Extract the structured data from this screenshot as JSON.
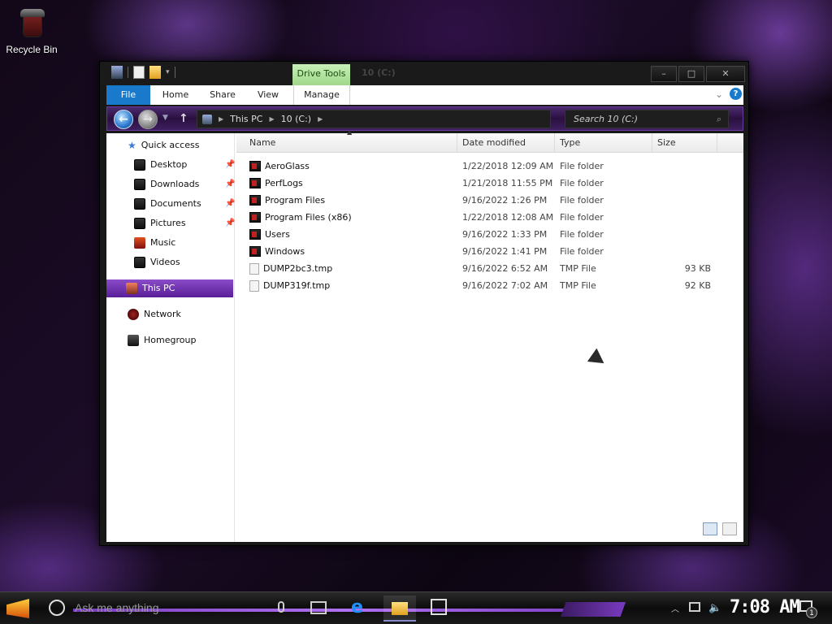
{
  "desktop": {
    "recycle_bin_label": "Recycle Bin"
  },
  "window": {
    "title": "10 (C:)",
    "context_tab": "Drive Tools",
    "caption": {
      "minimize": "–",
      "maximize": "□",
      "close": "✕"
    }
  },
  "ribbon": {
    "tabs": {
      "file": "File",
      "home": "Home",
      "share": "Share",
      "view": "View",
      "manage": "Manage"
    },
    "help": "?"
  },
  "address": {
    "crumbs": [
      "This PC",
      "10 (C:)"
    ],
    "search_placeholder": "Search 10 (C:)"
  },
  "nav_pane": {
    "quick_access": "Quick access",
    "items": [
      {
        "label": "Desktop",
        "pinned": true
      },
      {
        "label": "Downloads",
        "pinned": true
      },
      {
        "label": "Documents",
        "pinned": true
      },
      {
        "label": "Pictures",
        "pinned": true
      },
      {
        "label": "Music",
        "pinned": false
      },
      {
        "label": "Videos",
        "pinned": false
      }
    ],
    "this_pc": "This PC",
    "network": "Network",
    "homegroup": "Homegroup"
  },
  "columns": {
    "name": "Name",
    "date": "Date modified",
    "type": "Type",
    "size": "Size"
  },
  "files": [
    {
      "name": "AeroGlass",
      "date": "1/22/2018 12:09 AM",
      "type": "File folder",
      "size": "",
      "kind": "folder"
    },
    {
      "name": "PerfLogs",
      "date": "1/21/2018 11:55 PM",
      "type": "File folder",
      "size": "",
      "kind": "folder"
    },
    {
      "name": "Program Files",
      "date": "9/16/2022 1:26 PM",
      "type": "File folder",
      "size": "",
      "kind": "folder"
    },
    {
      "name": "Program Files (x86)",
      "date": "1/22/2018 12:08 AM",
      "type": "File folder",
      "size": "",
      "kind": "folder"
    },
    {
      "name": "Users",
      "date": "9/16/2022 1:33 PM",
      "type": "File folder",
      "size": "",
      "kind": "folder"
    },
    {
      "name": "Windows",
      "date": "9/16/2022 1:41 PM",
      "type": "File folder",
      "size": "",
      "kind": "folder"
    },
    {
      "name": "DUMP2bc3.tmp",
      "date": "9/16/2022 6:52 AM",
      "type": "TMP File",
      "size": "93 KB",
      "kind": "file"
    },
    {
      "name": "DUMP319f.tmp",
      "date": "9/16/2022 7:02 AM",
      "type": "TMP File",
      "size": "92 KB",
      "kind": "file"
    }
  ],
  "taskbar": {
    "search_placeholder": "Ask me anything",
    "clock": "7:08 AM",
    "notification_count": "1"
  },
  "colors": {
    "accent": "#7a3ac0",
    "file_tab": "#1979ca",
    "context_tab": "#9fd88a"
  }
}
